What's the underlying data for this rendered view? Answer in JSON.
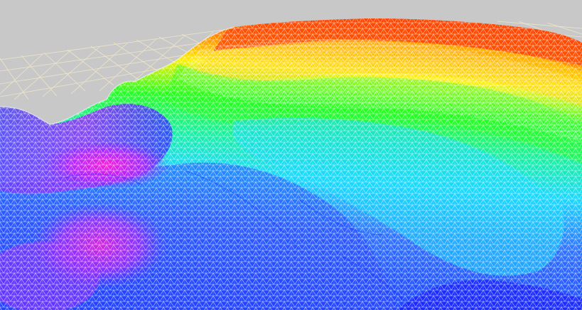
{
  "scene": {
    "background_color": "#c8c8c8",
    "ground_grid_color": "#f3e9c8",
    "wire_color": "#ffffff",
    "colormap": [
      "#0a18ff",
      "#2f73ff",
      "#1ad8ff",
      "#19f0a0",
      "#26ff1e",
      "#ffee00",
      "#ff7a00",
      "#ff2a00",
      "#ff1cd4",
      "#c61cff"
    ],
    "mesh_layers": [
      {
        "name": "far-ridge-red"
      },
      {
        "name": "orange-yellow-slope"
      },
      {
        "name": "green-band"
      },
      {
        "name": "cyan-plain"
      },
      {
        "name": "blue-lowland"
      },
      {
        "name": "magenta-valley"
      }
    ]
  }
}
